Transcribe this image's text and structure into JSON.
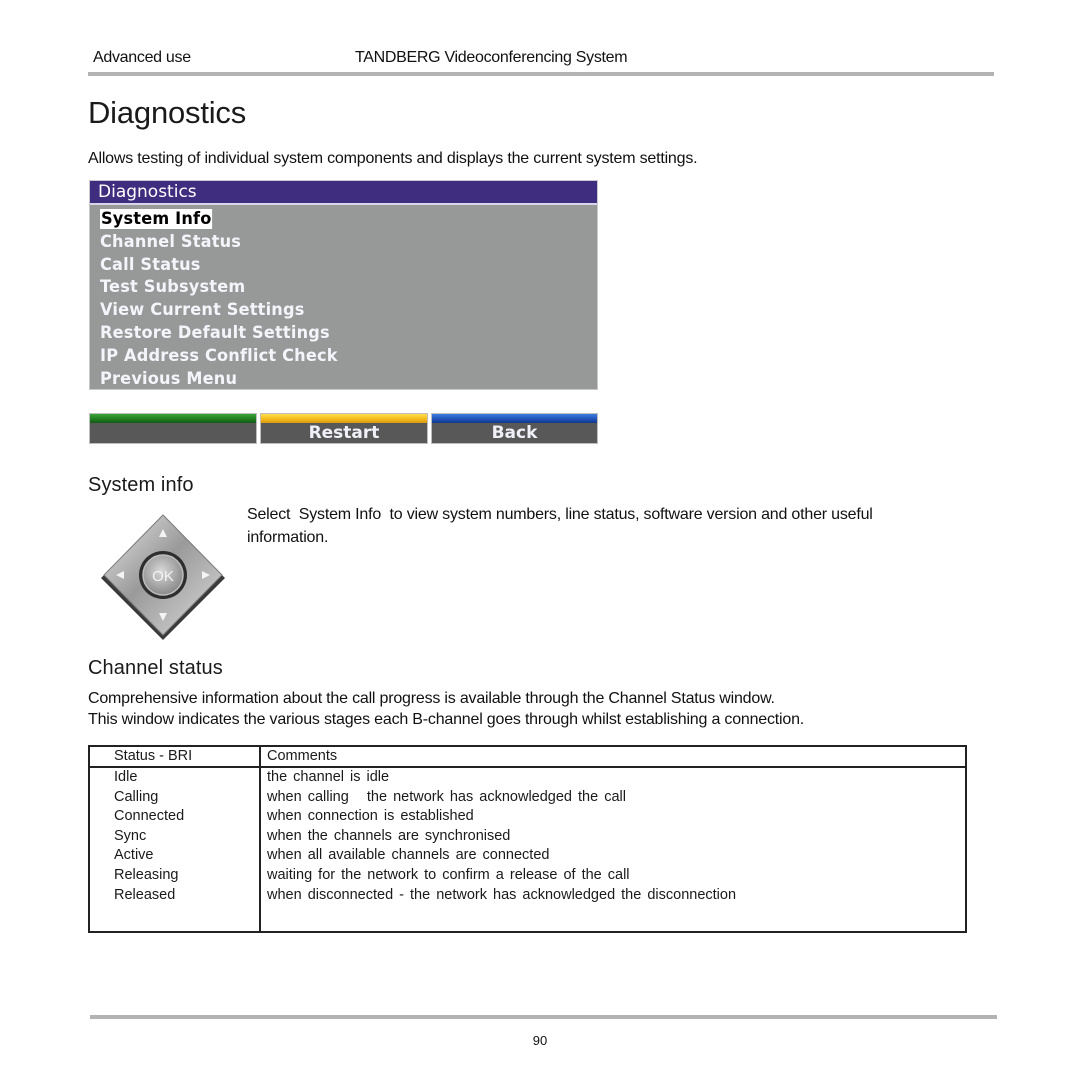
{
  "header": {
    "section": "Advanced use",
    "doc_title": "TANDBERG Videoconferencing System"
  },
  "page_title": "Diagnostics",
  "intro": "Allows testing of individual system components and displays the current system settings.",
  "osd_menu": {
    "title": "Diagnostics",
    "items": [
      {
        "label": "System Info",
        "selected": true
      },
      {
        "label": "Channel Status"
      },
      {
        "label": "Call Status"
      },
      {
        "label": "Test Subsystem"
      },
      {
        "label": "View Current Settings"
      },
      {
        "label": "Restore Default Settings"
      },
      {
        "label": "IP Address Conflict Check"
      },
      {
        "label": "Previous Menu"
      }
    ],
    "softkeys": [
      {
        "label": "",
        "color": "#1f7a1f"
      },
      {
        "label": "Restart",
        "color": "#f2b81a"
      },
      {
        "label": "Back",
        "color": "#1f4fb5"
      }
    ]
  },
  "system_info": {
    "heading": "System info",
    "text_line1": "Select  System Info  to view system numbers, line status, software version and other useful",
    "text_line2": "information.",
    "remote_ok_label": "OK"
  },
  "channel_status": {
    "heading": "Channel status",
    "para_line1": "Comprehensive information about the call progress is available through the Channel Status window.",
    "para_line2": "This window indicates the various stages each B-channel goes through whilst establishing a connection.",
    "table": {
      "columns": [
        "Status - BRI",
        "Comments"
      ],
      "rows": [
        [
          "Idle",
          "the channel is idle"
        ],
        [
          "Calling",
          "when calling   the network has acknowledged the call"
        ],
        [
          "Connected",
          "when connection is established"
        ],
        [
          "Sync",
          "when the channels are synchronised"
        ],
        [
          "Active",
          "when all available channels are connected"
        ],
        [
          "Releasing",
          "waiting for the network to confirm a release of the call"
        ],
        [
          "Released",
          "when disconnected - the network has acknowledged the disconnection"
        ]
      ]
    }
  },
  "footer": {
    "page_number": "90"
  }
}
